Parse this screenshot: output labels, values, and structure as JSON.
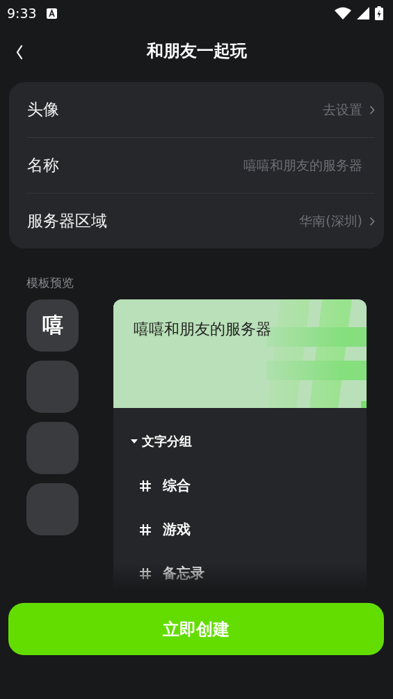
{
  "status_bar": {
    "time": "9:33"
  },
  "header": {
    "title": "和朋友一起玩"
  },
  "settings": [
    {
      "label": "头像",
      "value": "去设置",
      "has_chevron": true
    },
    {
      "label": "名称",
      "value": "嘻嘻和朋友的服务器",
      "has_chevron": false
    },
    {
      "label": "服务器区域",
      "value": "华南(深圳)",
      "has_chevron": true
    }
  ],
  "template": {
    "heading": "模板预览",
    "thumbnails": [
      {
        "kind": "letter",
        "text": "嘻"
      },
      {
        "kind": "blank"
      },
      {
        "kind": "blank"
      },
      {
        "kind": "blank"
      }
    ],
    "preview": {
      "server_name": "嘻嘻和朋友的服务器",
      "group": {
        "name": "文字分组",
        "expanded": true,
        "channels": [
          "综合",
          "游戏",
          "备忘录"
        ]
      }
    }
  },
  "create_button": "立即创建"
}
